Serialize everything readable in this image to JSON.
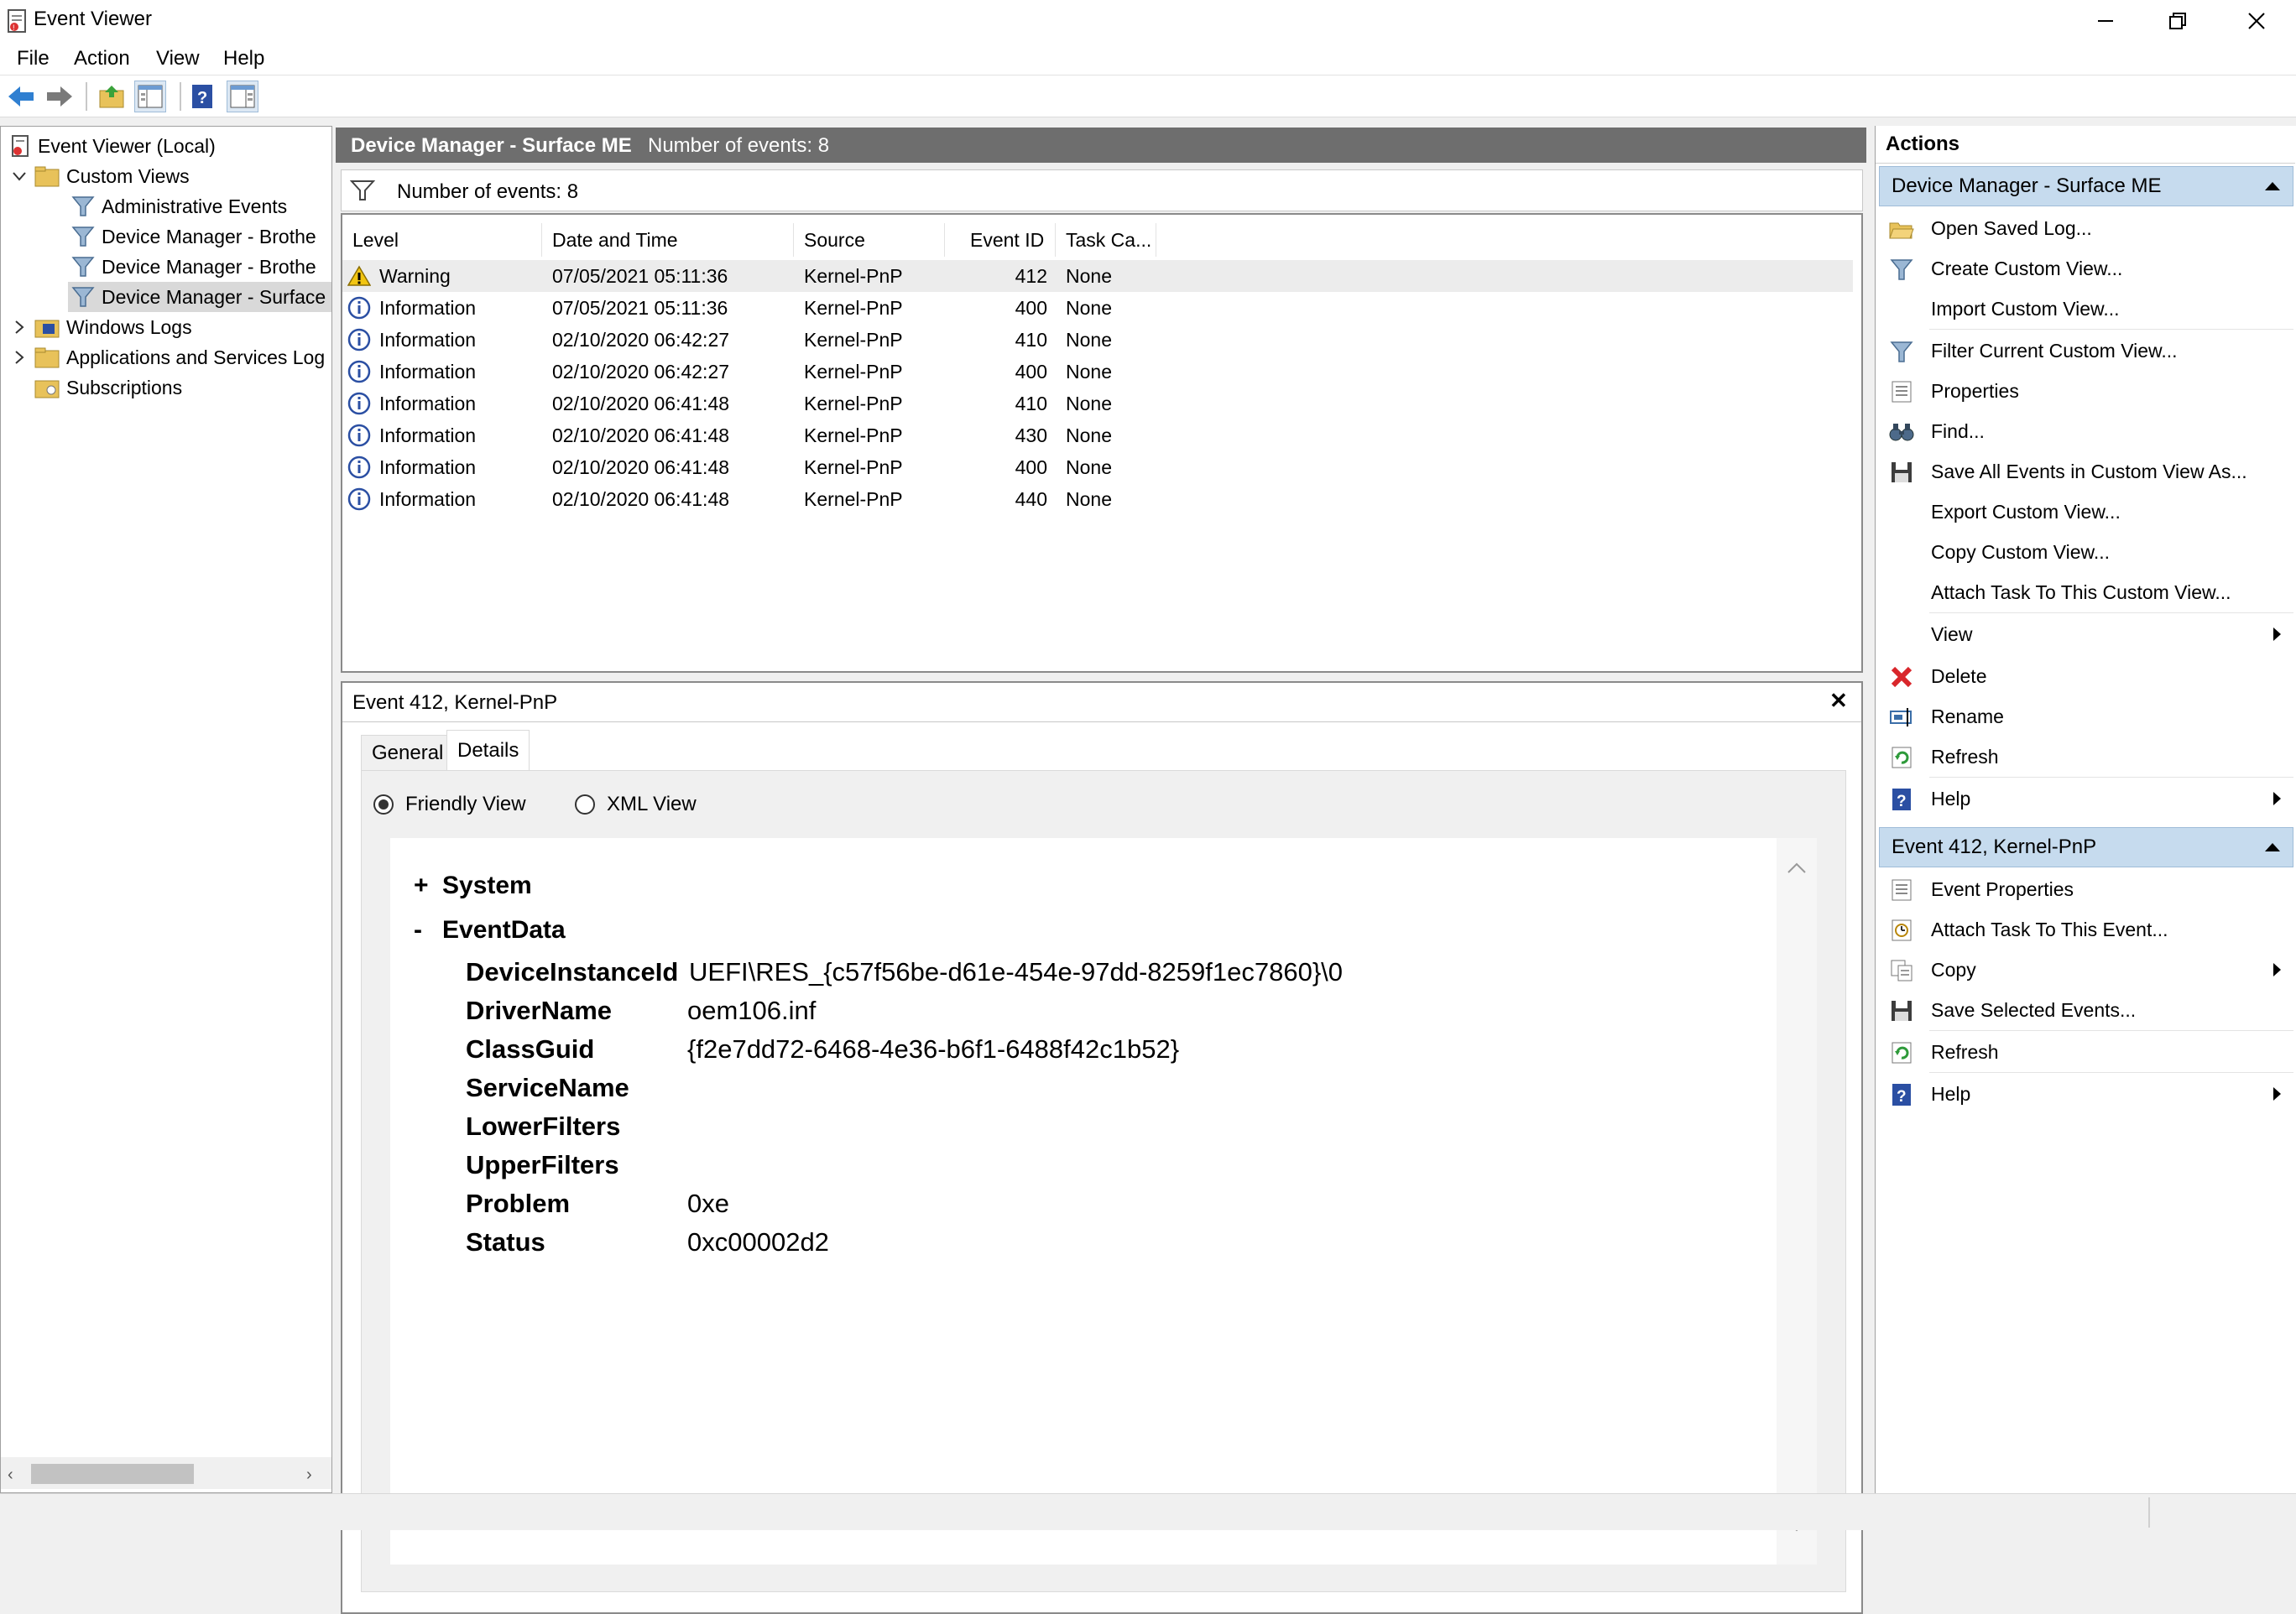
{
  "window": {
    "title": "Event Viewer"
  },
  "menu": [
    "File",
    "Action",
    "View",
    "Help"
  ],
  "tree": {
    "root": "Event Viewer (Local)",
    "custom_views": "Custom Views",
    "items": [
      "Administrative Events",
      "Device Manager - Brothe",
      "Device Manager - Brothe",
      "Device Manager - Surface"
    ],
    "windows_logs": "Windows Logs",
    "apps_services": "Applications and Services Log",
    "subscriptions": "Subscriptions"
  },
  "center": {
    "header_name": "Device Manager - Surface ME",
    "header_count": "Number of events: 8",
    "filter_count": "Number of events: 8",
    "columns": [
      "Level",
      "Date and Time",
      "Source",
      "Event ID",
      "Task Ca..."
    ],
    "rows": [
      {
        "level": "Warning",
        "date": "07/05/2021 05:11:36",
        "source": "Kernel-PnP",
        "id": "412",
        "task": "None"
      },
      {
        "level": "Information",
        "date": "07/05/2021 05:11:36",
        "source": "Kernel-PnP",
        "id": "400",
        "task": "None"
      },
      {
        "level": "Information",
        "date": "02/10/2020 06:42:27",
        "source": "Kernel-PnP",
        "id": "410",
        "task": "None"
      },
      {
        "level": "Information",
        "date": "02/10/2020 06:42:27",
        "source": "Kernel-PnP",
        "id": "400",
        "task": "None"
      },
      {
        "level": "Information",
        "date": "02/10/2020 06:41:48",
        "source": "Kernel-PnP",
        "id": "410",
        "task": "None"
      },
      {
        "level": "Information",
        "date": "02/10/2020 06:41:48",
        "source": "Kernel-PnP",
        "id": "430",
        "task": "None"
      },
      {
        "level": "Information",
        "date": "02/10/2020 06:41:48",
        "source": "Kernel-PnP",
        "id": "400",
        "task": "None"
      },
      {
        "level": "Information",
        "date": "02/10/2020 06:41:48",
        "source": "Kernel-PnP",
        "id": "440",
        "task": "None"
      }
    ]
  },
  "detail": {
    "title": "Event 412, Kernel-PnP",
    "close": "✕",
    "tabs": [
      "General",
      "Details"
    ],
    "view_friendly": "Friendly View",
    "view_xml": "XML View",
    "system_toggle": "+",
    "system_label": "System",
    "eventdata_toggle": "-",
    "eventdata_label": "EventData",
    "fields": [
      {
        "name": "DeviceInstanceId",
        "value": "UEFI\\RES_{c57f56be-d61e-454e-97dd-8259f1ec7860}\\0"
      },
      {
        "name": "DriverName",
        "value": "oem106.inf"
      },
      {
        "name": "ClassGuid",
        "value": "{f2e7dd72-6468-4e36-b6f1-6488f42c1b52}"
      },
      {
        "name": "ServiceName",
        "value": ""
      },
      {
        "name": "LowerFilters",
        "value": ""
      },
      {
        "name": "UpperFilters",
        "value": ""
      },
      {
        "name": "Problem",
        "value": "0xe"
      },
      {
        "name": "Status",
        "value": "0xc00002d2"
      }
    ]
  },
  "actions": {
    "title": "Actions",
    "section1": "Device Manager - Surface ME",
    "items1": [
      {
        "label": "Open Saved Log...",
        "icon": "open-folder-icon"
      },
      {
        "label": "Create Custom View...",
        "icon": "funnel-icon"
      },
      {
        "label": "Import Custom View...",
        "icon": ""
      },
      {
        "label": "Filter Current Custom View...",
        "icon": "funnel-icon"
      },
      {
        "label": "Properties",
        "icon": "properties-icon"
      },
      {
        "label": "Find...",
        "icon": "binoculars-icon"
      },
      {
        "label": "Save All Events in Custom View As...",
        "icon": "floppy-icon"
      },
      {
        "label": "Export Custom View...",
        "icon": ""
      },
      {
        "label": "Copy Custom View...",
        "icon": ""
      },
      {
        "label": "Attach Task To This Custom View...",
        "icon": ""
      },
      {
        "label": "View",
        "icon": "",
        "submenu": true
      },
      {
        "label": "Delete",
        "icon": "delete-icon"
      },
      {
        "label": "Rename",
        "icon": "rename-icon"
      },
      {
        "label": "Refresh",
        "icon": "refresh-icon"
      },
      {
        "label": "Help",
        "icon": "help-icon",
        "submenu": true
      }
    ],
    "section2": "Event 412, Kernel-PnP",
    "items2": [
      {
        "label": "Event Properties",
        "icon": "properties-icon"
      },
      {
        "label": "Attach Task To This Event...",
        "icon": "task-icon"
      },
      {
        "label": "Copy",
        "icon": "copy-icon",
        "submenu": true
      },
      {
        "label": "Save Selected Events...",
        "icon": "floppy-icon"
      },
      {
        "label": "Refresh",
        "icon": "refresh-icon"
      },
      {
        "label": "Help",
        "icon": "help-icon",
        "submenu": true
      }
    ]
  },
  "colors": {
    "selection_header": "#c6dbee",
    "center_header": "#6e6e6e",
    "delete_red": "#d9262b",
    "help_blue": "#2b4fa3"
  }
}
